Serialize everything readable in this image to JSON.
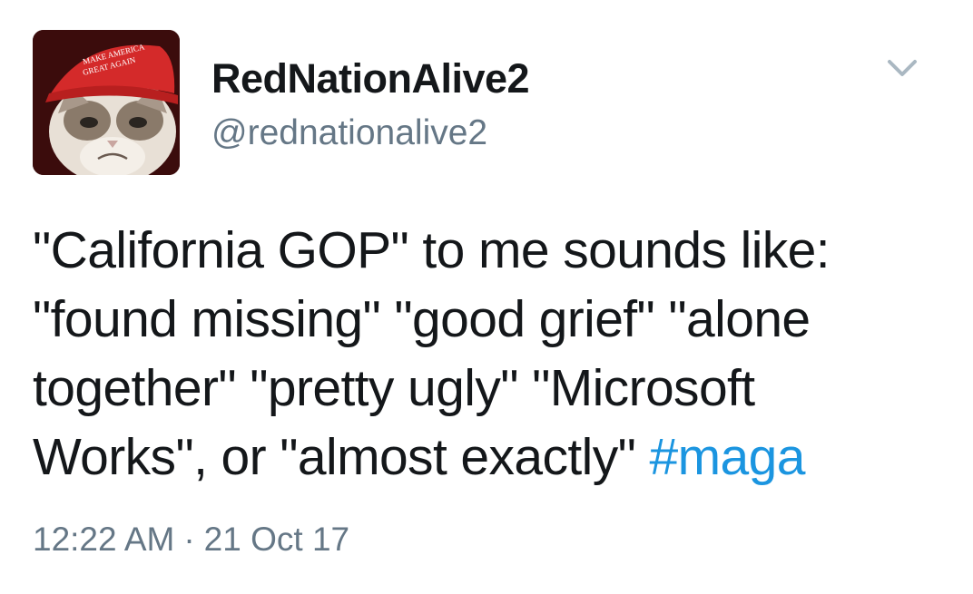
{
  "author": {
    "display_name": "RedNationAlive2",
    "handle": "@rednationalive2",
    "avatar": {
      "icon": "grumpy-cat-avatar",
      "hat_text_line1": "MAKE AMERICA",
      "hat_text_line2": "GREAT AGAIN",
      "hat_color": "#d42a2a"
    }
  },
  "menu": {
    "icon": "chevron-down-icon"
  },
  "tweet": {
    "lines": [
      "\"California GOP\" to me sounds like:",
      "\"found missing\" \"good grief\" \"alone",
      "together\" \"pretty ugly\" \"Microsoft",
      "Works\", or \"almost exactly\" "
    ],
    "hashtag": "#maga",
    "hashtag_color": "#1b95e0"
  },
  "meta": {
    "time": "12:22 AM",
    "separator": "·",
    "date": "21 Oct 17"
  }
}
